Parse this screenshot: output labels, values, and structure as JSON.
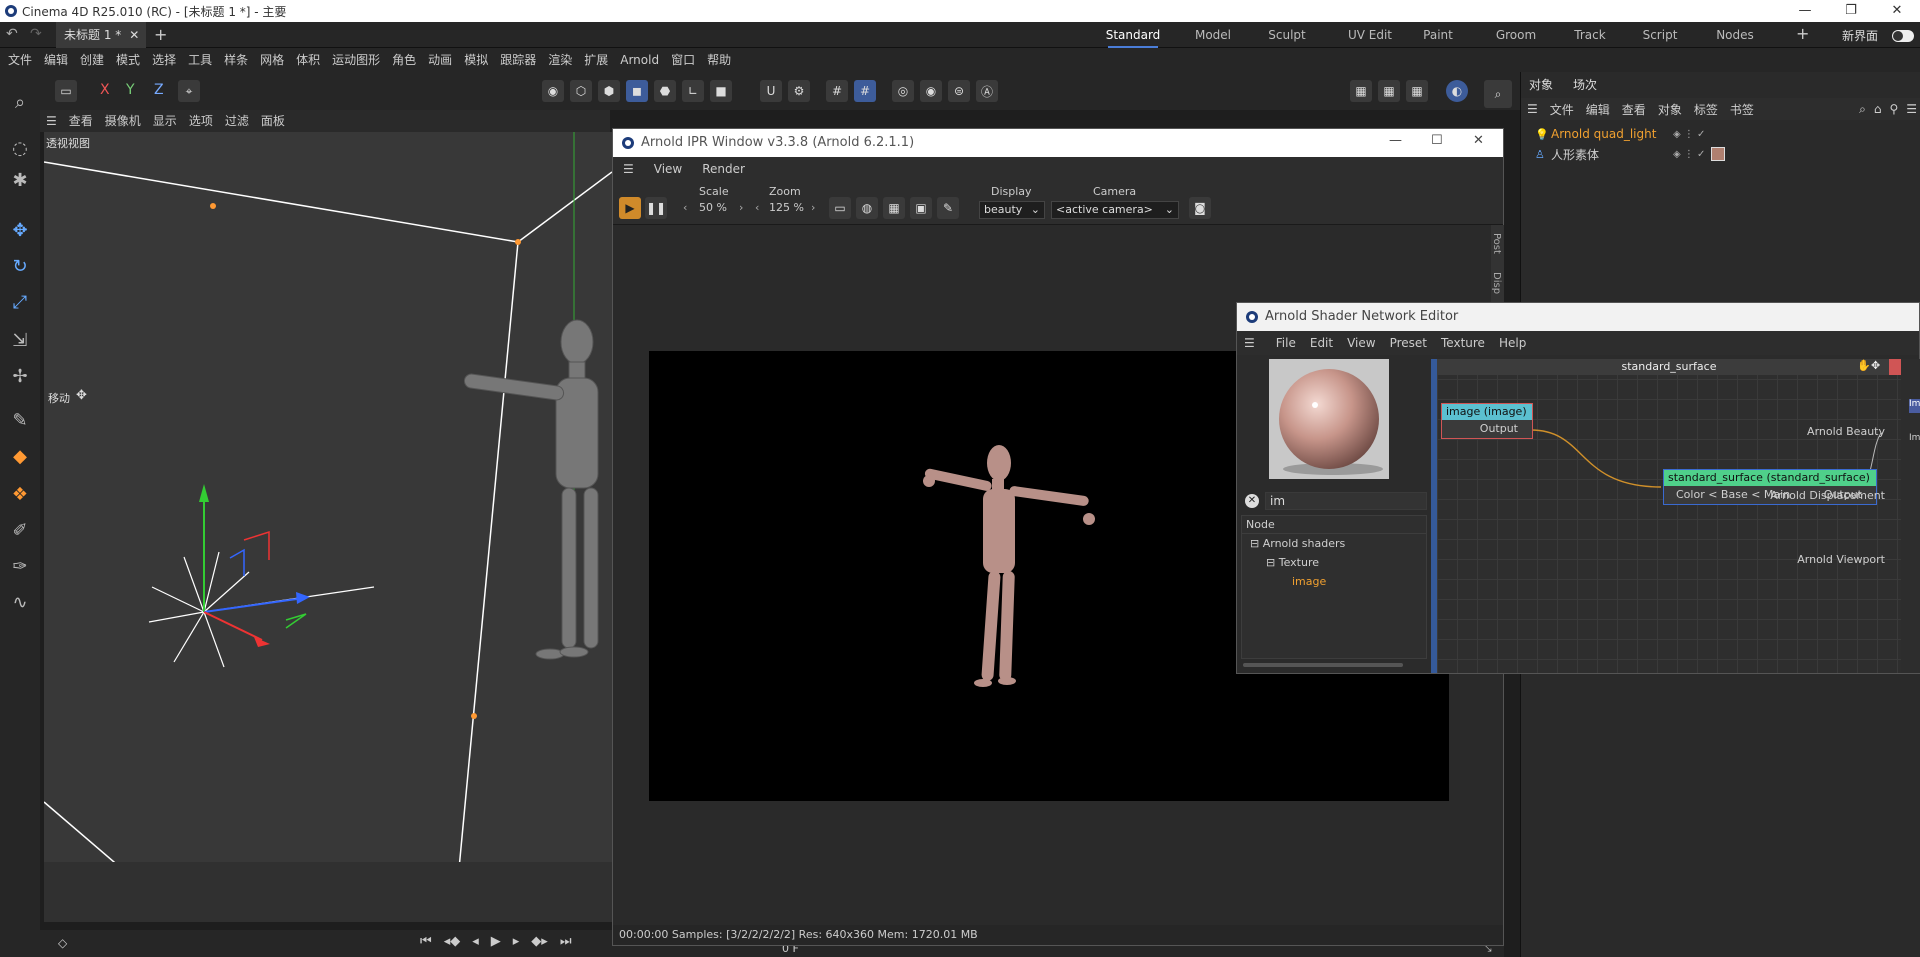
{
  "window": {
    "title": "Cinema 4D R25.010 (RC) - [未标题 1 *] - 主要"
  },
  "doc_tab": {
    "label": "未标题 1 *"
  },
  "layouts": [
    {
      "label": "Standard",
      "active": true
    },
    {
      "label": "Model"
    },
    {
      "label": "Sculpt"
    },
    {
      "label": "UV Edit"
    },
    {
      "label": "Paint"
    },
    {
      "label": "Groom"
    },
    {
      "label": "Track"
    },
    {
      "label": "Script"
    },
    {
      "label": "Nodes"
    }
  ],
  "new_layout": "新界面",
  "menu": [
    "文件",
    "编辑",
    "创建",
    "模式",
    "选择",
    "工具",
    "样条",
    "网格",
    "体积",
    "运动图形",
    "角色",
    "动画",
    "模拟",
    "跟踪器",
    "渲染",
    "扩展",
    "Arnold",
    "窗口",
    "帮助"
  ],
  "axis": {
    "x": "X",
    "y": "Y",
    "z": "Z"
  },
  "viewport": {
    "menu": [
      "查看",
      "摄像机",
      "显示",
      "选项",
      "过滤",
      "面板"
    ],
    "label": "透视视图",
    "move_label": "移动"
  },
  "ipr": {
    "title": "Arnold IPR Window v3.3.8 (Arnold 6.2.1.1)",
    "menu": [
      "View",
      "Render"
    ],
    "scale_label": "Scale",
    "scale_value": "50 %",
    "zoom_label": "Zoom",
    "zoom_value": "125 %",
    "display_label": "Display",
    "display_value": "beauty",
    "camera_label": "Camera",
    "camera_value": "<active camera>",
    "side_tabs": [
      "Post",
      "Disp"
    ],
    "status": "00:00:00  Samples: [3/2/2/2/2/2]  Res: 640x360  Mem: 1720.01 MB"
  },
  "sne": {
    "title": "Arnold Shader Network Editor",
    "menu": [
      "File",
      "Edit",
      "View",
      "Preset",
      "Texture",
      "Help"
    ],
    "search": "im",
    "node_header": "Node",
    "tree": [
      "Arnold shaders",
      "Texture",
      "image"
    ],
    "graph_title": "standard_surface",
    "image_node": {
      "title": "image (image)",
      "port": "Output"
    },
    "surface_node": {
      "title": "standard_surface (standard_surface)",
      "in": "Color < Base < Main",
      "out": "Output"
    },
    "outputs": [
      "Arnold Beauty",
      "Arnold Displacement",
      "Arnold Viewport"
    ],
    "right_clip": [
      "Im",
      "Ima"
    ]
  },
  "objects": {
    "tabs": [
      "对象",
      "场次"
    ],
    "menu": [
      "文件",
      "编辑",
      "查看",
      "对象",
      "标签",
      "书签"
    ],
    "items": [
      {
        "name": "Arnold quad_light",
        "color": "#f0a030"
      },
      {
        "name": "人形素体",
        "color": "#cfcfcf"
      }
    ]
  },
  "timeline": {
    "frame": "0 F"
  },
  "colors": {
    "accent": "#4a7dd8",
    "node_image": "#5bc0d0",
    "node_surface": "#4fd08a",
    "wire": "#d0902a"
  }
}
